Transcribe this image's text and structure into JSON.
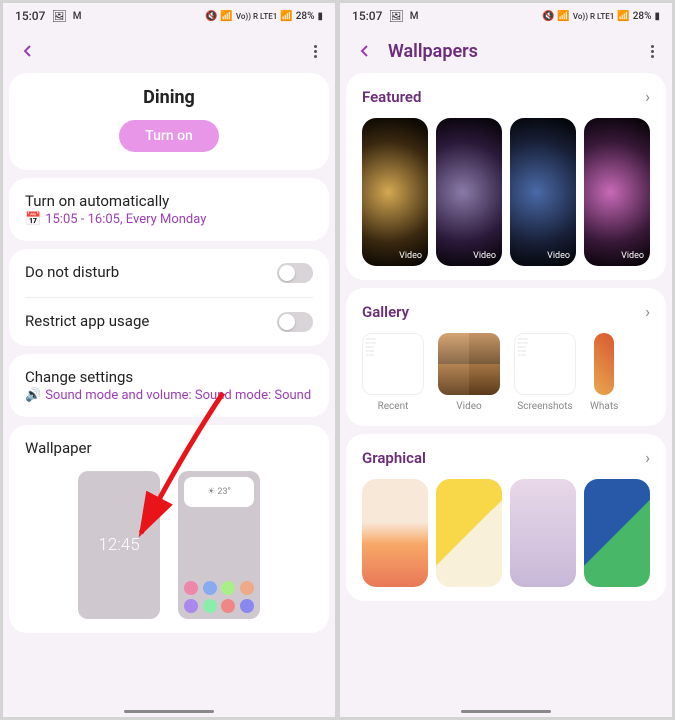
{
  "status": {
    "time": "15:07",
    "battery": "28%",
    "network": "Vo)) R LTE1"
  },
  "left_screen": {
    "mode_title": "Dining",
    "turn_on_label": "Turn on",
    "auto": {
      "label": "Turn on automatically",
      "sub": "15:05 - 16:05, Every Monday"
    },
    "dnd_label": "Do not disturb",
    "restrict_label": "Restrict app usage",
    "change_label": "Change settings",
    "change_sub": "Sound mode and volume: Sound mode: Sound",
    "wallpaper_label": "Wallpaper",
    "lock_preview_time": "12:45",
    "home_preview_temp": "☀ 23°"
  },
  "right_screen": {
    "title": "Wallpapers",
    "featured": {
      "title": "Featured",
      "badge": "Video"
    },
    "gallery": {
      "title": "Gallery",
      "items": [
        "Recent",
        "Video",
        "Screenshots",
        "Whats"
      ]
    },
    "graphical": {
      "title": "Graphical"
    }
  }
}
